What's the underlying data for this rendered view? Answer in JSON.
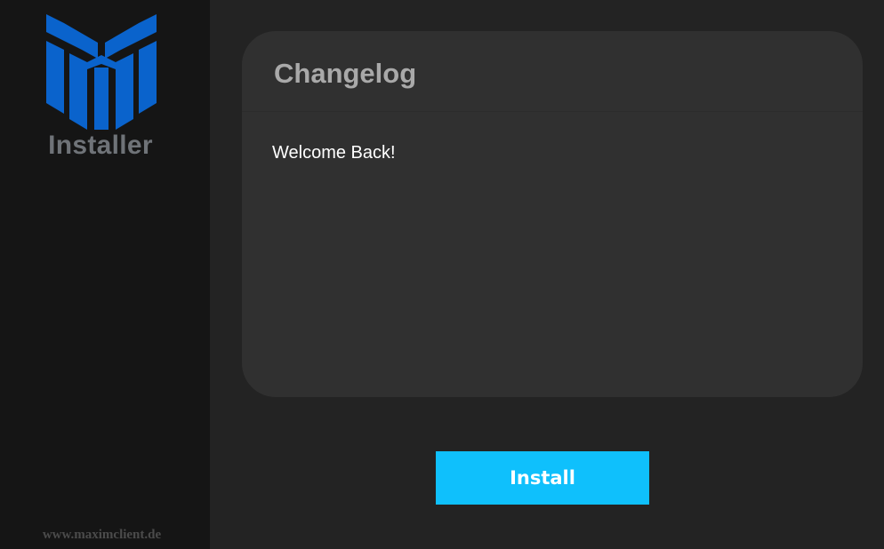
{
  "sidebar": {
    "logo_icon": "maxim-m-logo",
    "brand": "Installer",
    "website": "www.maximclient.de"
  },
  "main": {
    "changelog": {
      "title": "Changelog",
      "body": "Welcome Back!"
    },
    "install_label": "Install"
  },
  "colors": {
    "sidebar_bg": "#151515",
    "main_bg": "#232323",
    "card_bg": "#303030",
    "logo_blue": "#0a63cc",
    "accent": "#0fc0fc"
  }
}
